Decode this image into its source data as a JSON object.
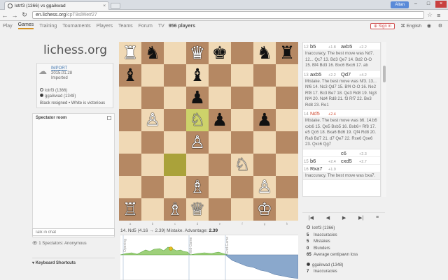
{
  "browser": {
    "tab_title": "lotrf3 (1366) vs ggaikwad",
    "user": "Aitan",
    "url_domain": "en.lichess.org",
    "url_path": "/cpT8slWe#27"
  },
  "site_nav": {
    "items": [
      "Play",
      "Games",
      "Training",
      "Tournaments",
      "Players",
      "Teams",
      "Forum",
      "TV"
    ],
    "active": "Games",
    "players_count": "956 players",
    "sign_in": "Sign in",
    "language": "English"
  },
  "logo": "lichess.org",
  "game_info": {
    "import_label": "IMPORT",
    "date": "2015.01.28",
    "type": "Imported",
    "white_player": "lotrf3 (1366)",
    "black_player": "ggaikwad (1348)",
    "result": "Black resigned • White is victorious"
  },
  "spectator_room": {
    "title": "Spectator room",
    "chat_placeholder": "Talk in chat",
    "spectators": "1 Spectators: Anonymous"
  },
  "keyboard_shortcuts": "Keyboard Shortcuts",
  "board": {
    "ranks": [
      [
        "♜",
        "♞",
        "",
        "♛",
        "♚",
        "",
        "♞",
        "♜"
      ],
      [
        "♝",
        "",
        "",
        "♝",
        "",
        "",
        "",
        ""
      ],
      [
        "",
        "",
        "",
        "♟",
        "",
        "",
        "",
        ""
      ],
      [
        "",
        "♙",
        "",
        "♘",
        "♟",
        "",
        "♟",
        ""
      ],
      [
        "",
        "",
        "",
        "♙",
        "",
        "",
        "",
        ""
      ],
      [
        "",
        "",
        "",
        "",
        "",
        "♘",
        "",
        ""
      ],
      [
        "",
        "",
        "",
        "♗",
        "",
        "",
        "♙",
        ""
      ],
      [
        "♖",
        "",
        "♗",
        "♕",
        "",
        "",
        "♔",
        ""
      ]
    ],
    "colors": [
      [
        "w",
        "b",
        "",
        "w",
        "b",
        "",
        "b",
        "b"
      ],
      [
        "b",
        "",
        "",
        "b",
        "",
        "",
        "",
        ""
      ],
      [
        "",
        "",
        "",
        "b",
        "",
        "",
        "",
        ""
      ],
      [
        "",
        "w",
        "",
        "w",
        "b",
        "",
        "b",
        ""
      ],
      [
        "",
        "",
        "",
        "w",
        "",
        "",
        "",
        ""
      ],
      [
        "",
        "",
        "",
        "",
        "",
        "w",
        "",
        ""
      ],
      [
        "",
        "",
        "",
        "w",
        "",
        "",
        "w",
        ""
      ],
      [
        "w",
        "",
        "w",
        "w",
        "",
        "",
        "w",
        ""
      ]
    ],
    "highlight_light": "d5",
    "highlight_dark": "c3",
    "files": [
      "a",
      "b",
      "c",
      "d",
      "e",
      "f",
      "g",
      "h"
    ]
  },
  "move_status": {
    "text": "14. Nd5 (4.16 → 2.39) Mistake. Advantage: ",
    "advantage": "2.39"
  },
  "graph_labels": [
    "Opening",
    "Mid-Game",
    "End-Game"
  ],
  "moves": [
    {
      "num": "12",
      "white": "b5",
      "we": "+1.8",
      "black": "axb5",
      "be": "+2.2"
    },
    {
      "comment": "Inaccuracy. The best move was Nd7. 12... Qc7 13. Bd3 Qe7 14. Bd2 O-O 15. Bf4 Bd3 16. Bxc6 Bxc6 17. ab"
    },
    {
      "num": "13",
      "white": "axb5",
      "we": "+2.2",
      "black": "Qd7",
      "be": "+4.2"
    },
    {
      "comment": "Mistake. The best move was Nf3. 13... Nf6 14. Nc3 Qd7 15. Bf4 O-O 16. Ne2 Rf8 17. Bc3 Be7 18. Qe3 Rd8 19. Ng3 Nf4 20. Nd4 Rd8 21. f3 Rf7 22. Be3 Rd8 23. Re1"
    },
    {
      "num": "14",
      "white": "Nd5",
      "we": "+2.4",
      "black": "",
      "be": "",
      "current": true
    },
    {
      "comment": "Mistake. The best move was b6. 14.b6 cxb6 15. Qe5 Bxb5 16. Bxb6+ Rf8 17. e5 Qc6 18. Bxa6 Bd6 19. Qf4 Rd8 20. Ra6 Bd7 21. d7 Qe7 22. Rxe6 Qxe6 23. Qxc6 Qg7"
    },
    {
      "num": "",
      "white": "",
      "we": "",
      "black": "c6",
      "be": "+2.3"
    },
    {
      "num": "15",
      "white": "b6",
      "we": "+2.4",
      "black": "cxd5",
      "be": "+2.7"
    },
    {
      "num": "16",
      "white": "Rxa7",
      "we": "+1.9",
      "black": "",
      "be": ""
    },
    {
      "comment": "Inaccuracy. The best move was bxa7."
    }
  ],
  "controls": [
    "|◀",
    "◀",
    "▶",
    "▶|",
    "≡"
  ],
  "analysis": {
    "white_player": "lotrf3 (1366)",
    "white": [
      {
        "n": "5",
        "label": "Inaccuracies"
      },
      {
        "n": "5",
        "label": "Mistakes"
      },
      {
        "n": "0",
        "label": "Blunders"
      },
      {
        "n": "65",
        "label": "Average centipawn loss"
      }
    ],
    "black_player": "ggaikwad (1348)",
    "black": [
      {
        "n": "7",
        "label": "Inaccuracies"
      }
    ]
  },
  "colors": {
    "accent": "#d59120",
    "mistake": "#d04a30",
    "light_square": "#f0d9b5",
    "dark_square": "#b58863"
  },
  "icons": {
    "upload": "upload-icon",
    "eye": "eye-icon",
    "gear": "gear-icon"
  }
}
